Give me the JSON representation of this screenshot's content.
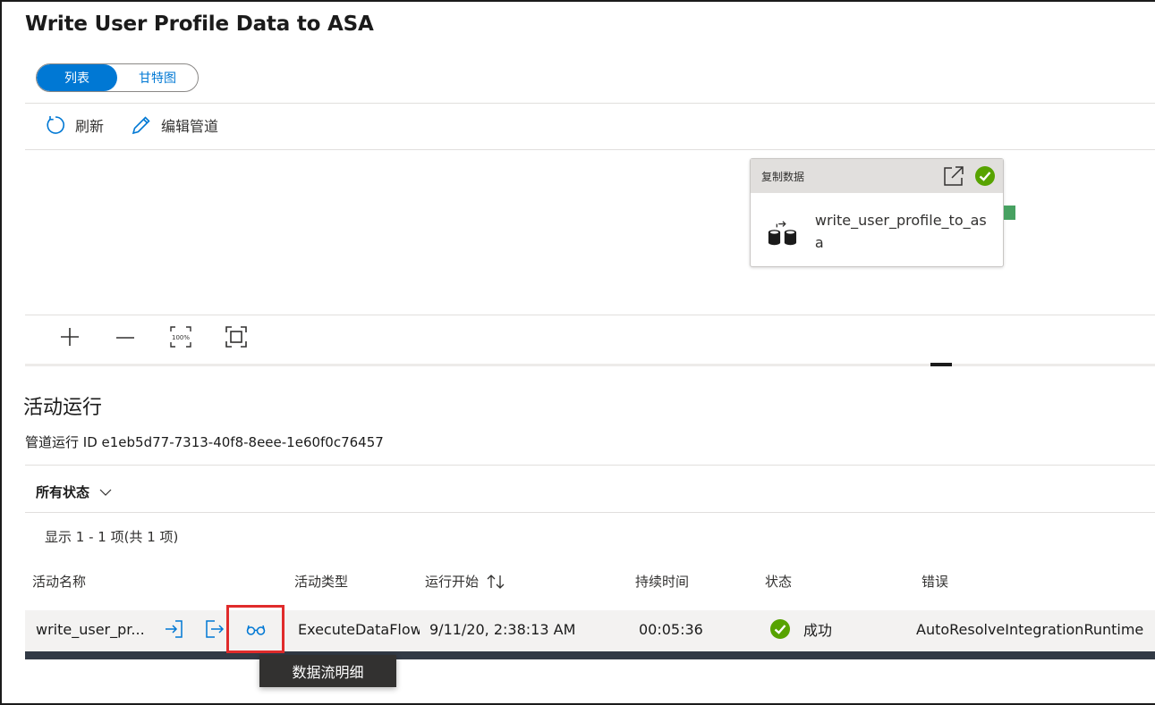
{
  "page": {
    "title": "Write User Profile Data to ASA"
  },
  "view_toggle": {
    "options": [
      "列表",
      "甘特图"
    ],
    "selected": "列表"
  },
  "toolbar": {
    "refresh_label": "刷新",
    "edit_pipeline_label": "编辑管道"
  },
  "activity_card": {
    "type_label": "复制数据",
    "name": "write_user_profile_to_asa",
    "status": "success"
  },
  "zoom_controls": {
    "zoom_100_label": "100%"
  },
  "activity_runs": {
    "title": "活动运行",
    "pipeline_run_id_label": "管道运行 ID",
    "pipeline_run_id": "e1eb5d77-7313-40f8-8eee-1e60f0c76457",
    "status_filter": "所有状态",
    "count_text": "显示 1 - 1 项(共 1 项)",
    "columns": [
      "活动名称",
      "活动类型",
      "运行开始",
      "持续时间",
      "状态",
      "错误"
    ],
    "rows": [
      {
        "name": "write_user_pr...",
        "type": "ExecuteDataFlow",
        "run_start": "9/11/20, 2:38:13 AM",
        "duration": "00:05:36",
        "status": "成功",
        "error": "AutoResolveIntegrationRuntime"
      }
    ],
    "tooltip": "数据流明细"
  },
  "colors": {
    "accent": "#0078d4",
    "success": "#57a300",
    "highlight": "#e02b2b",
    "port": "#47a161"
  }
}
